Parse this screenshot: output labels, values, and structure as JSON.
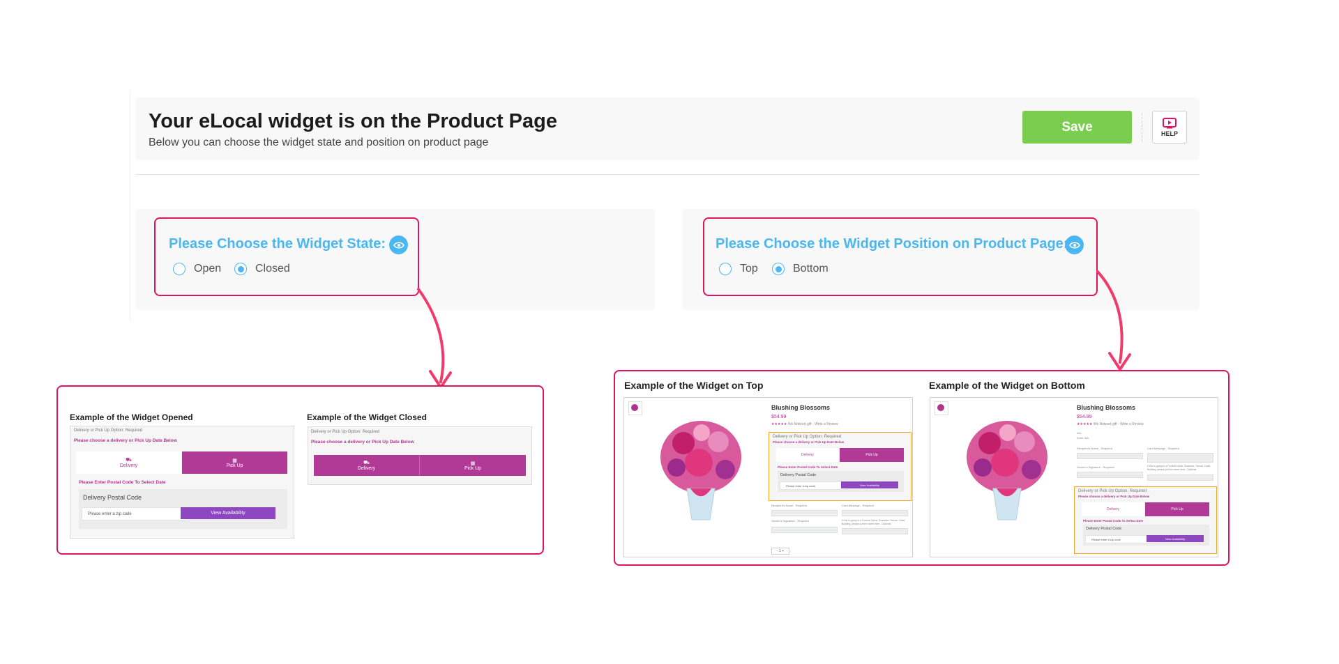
{
  "header": {
    "title": "Your eLocal widget is on the Product Page",
    "subtitle": "Below you can choose the widget state and position on product page",
    "save_label": "Save",
    "help_label": "HELP"
  },
  "state_panel": {
    "title": "Please Choose the Widget State:",
    "options": [
      "Open",
      "Closed"
    ],
    "selected": "Closed"
  },
  "position_panel": {
    "title": "Please Choose the Widget Position on Product Page:",
    "options": [
      "Top",
      "Bottom"
    ],
    "selected": "Bottom"
  },
  "examples_state": {
    "opened_title": "Example of the Widget Opened",
    "closed_title": "Example of the Widget Closed",
    "option_label": "Delivery or Pick Up Option:",
    "required": "Required",
    "choose_text": "Please choose a delivery or Pick Up Date Below",
    "delivery": "Delivery",
    "pickup": "Pick Up",
    "postal_prompt": "Please Enter Postal Code To Select Date",
    "postal_label": "Delivery Postal Code",
    "zip_placeholder": "Please enter a zip code",
    "view_availability": "View Availability"
  },
  "examples_position": {
    "top_title": "Example of the Widget on Top",
    "bottom_title": "Example of the Widget on Bottom",
    "product_name": "Blushing Blossoms",
    "price": "$54.99",
    "rating_text": "We Noticed gift - Write a Review",
    "recipient": "Recipient's Name - Required",
    "card_message": "Card Message - Required",
    "sender": "Sender's Signature - Required",
    "funeral_note": "If this is going to a Funeral Home, Business, School, Hotel, Building, please put the name here - Optional",
    "info_line": "Info",
    "info_sub": "Enter Info"
  },
  "colors": {
    "accent_blue": "#4ab7f2",
    "save_green": "#7acd4e",
    "highlight_red": "#e0135c",
    "widget_magenta": "#b03a96",
    "button_purple": "#8d47c1",
    "widget_outline": "#f0a828"
  }
}
